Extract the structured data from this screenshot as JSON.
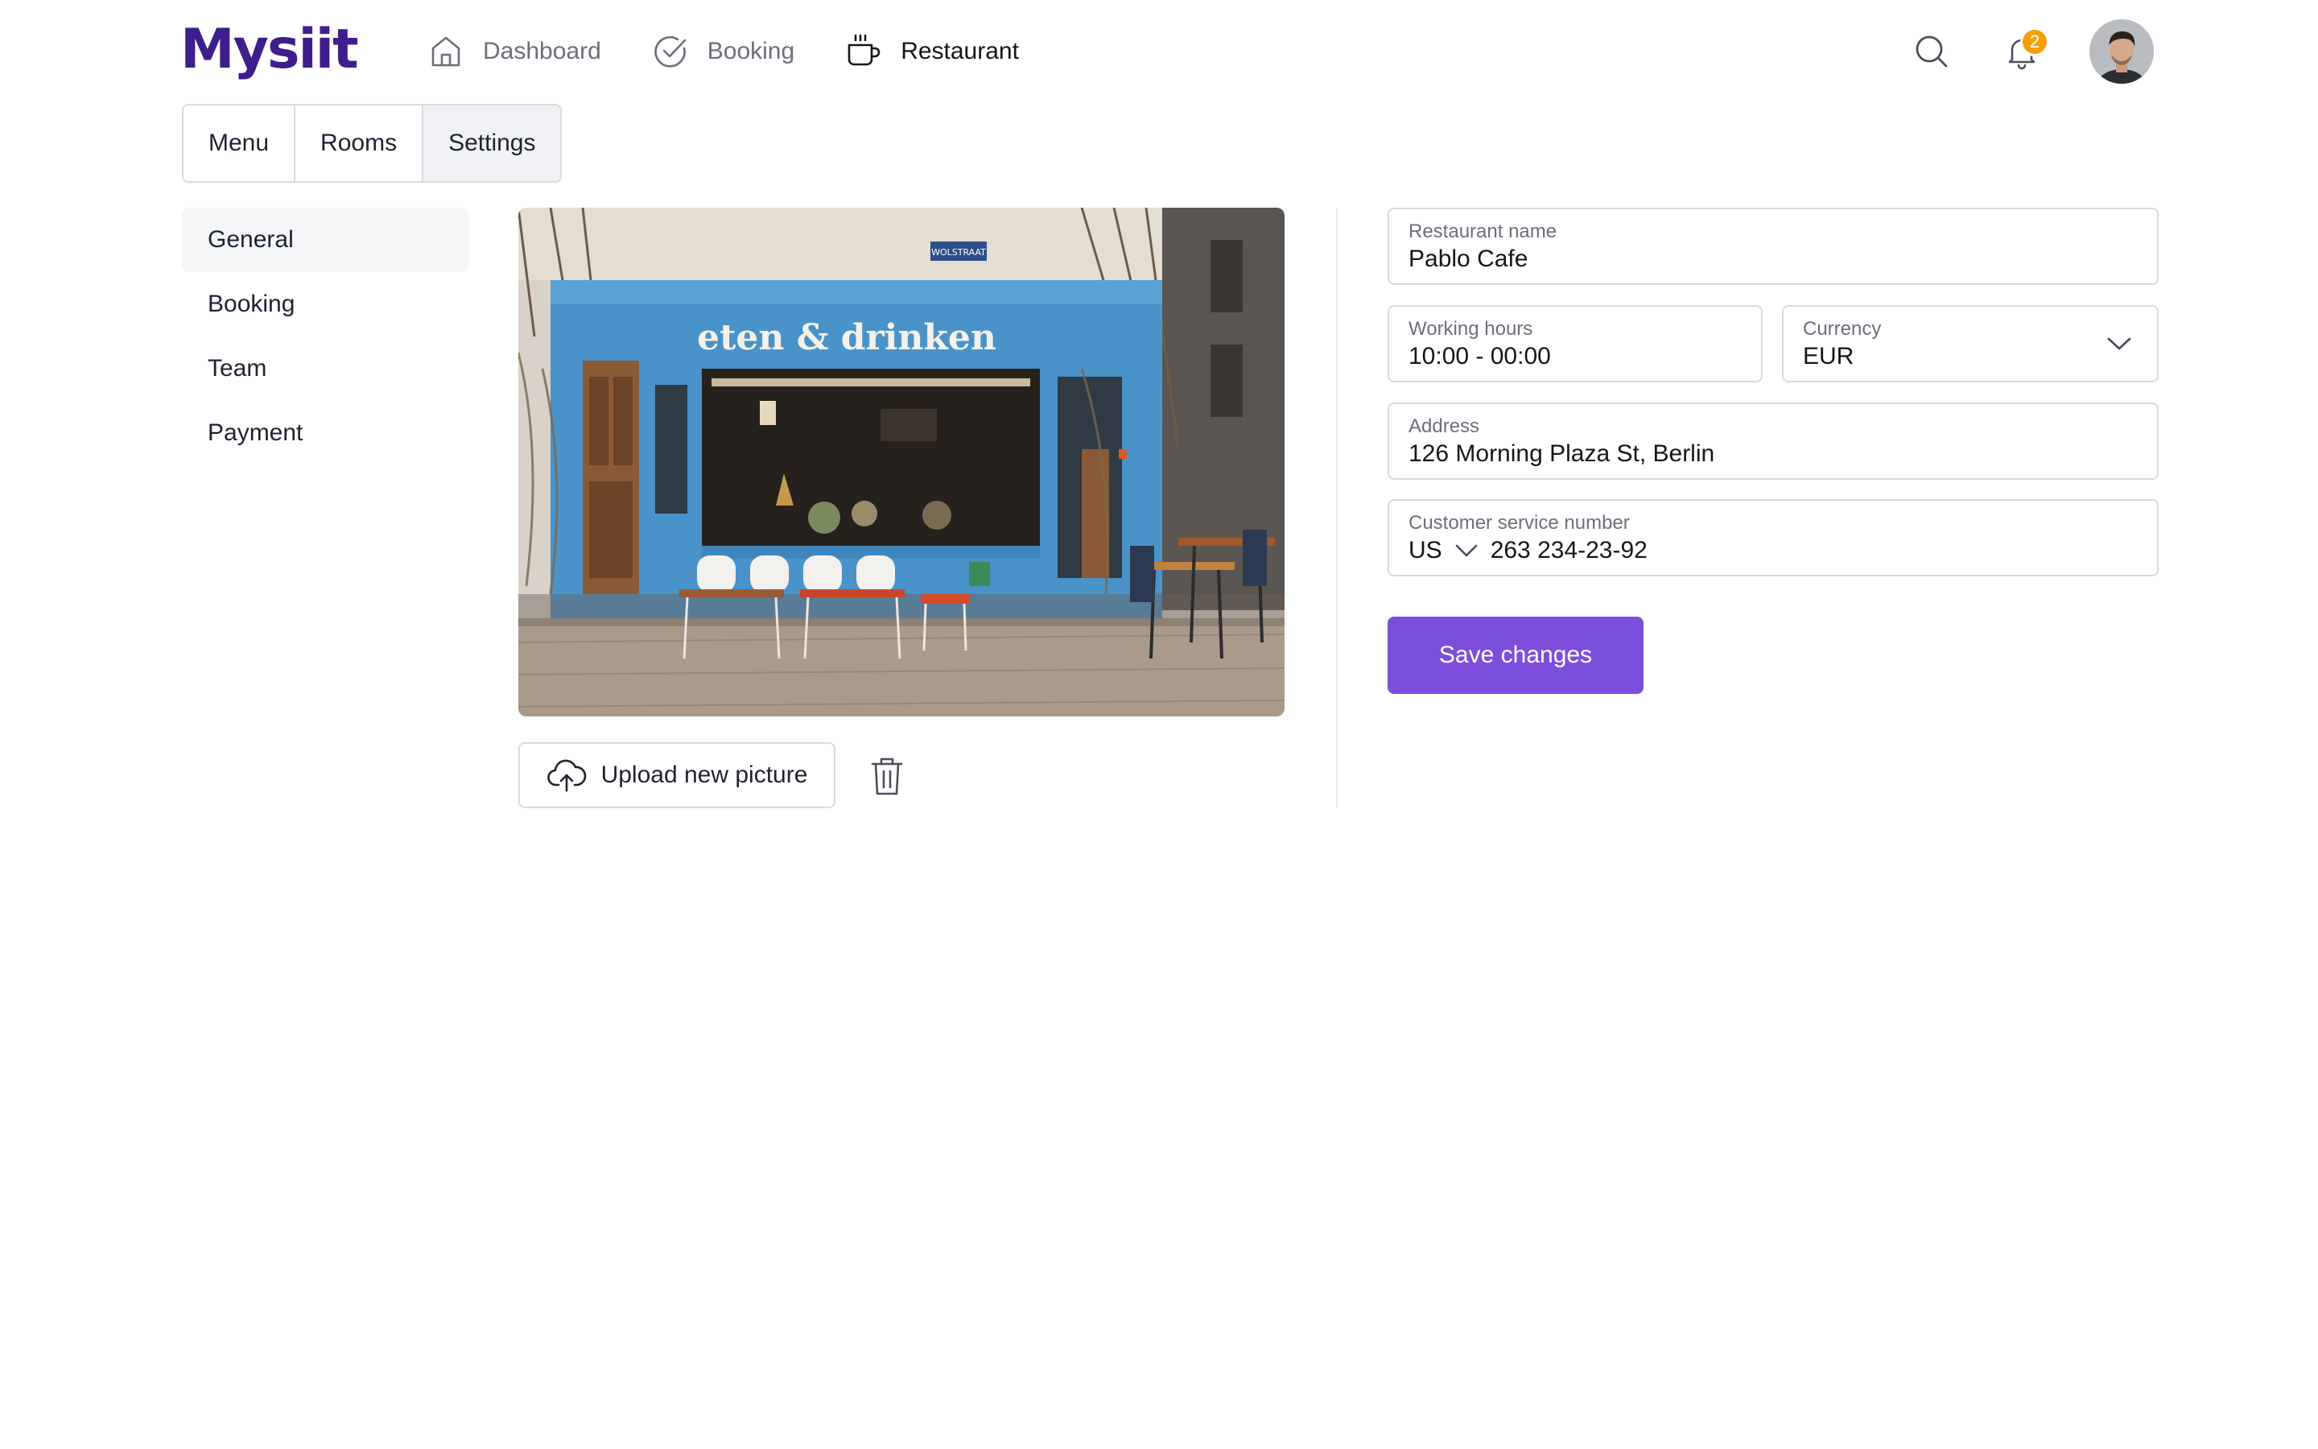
{
  "brand": {
    "logo": "Mysiit",
    "color": "#3f1d8c"
  },
  "nav": {
    "items": [
      {
        "label": "Dashboard",
        "icon": "home-icon",
        "active": false
      },
      {
        "label": "Booking",
        "icon": "check-circle-icon",
        "active": false
      },
      {
        "label": "Restaurant",
        "icon": "coffee-cup-icon",
        "active": true
      }
    ]
  },
  "header": {
    "search_icon": "search-icon",
    "notifications": {
      "icon": "bell-icon",
      "count": "2",
      "badge_color": "#f59e0b"
    },
    "avatar": "user-avatar"
  },
  "tabs": [
    {
      "label": "Menu",
      "active": false
    },
    {
      "label": "Rooms",
      "active": false
    },
    {
      "label": "Settings",
      "active": true
    }
  ],
  "sidemenu": {
    "items": [
      {
        "label": "General",
        "active": true
      },
      {
        "label": "Booking",
        "active": false
      },
      {
        "label": "Team",
        "active": false
      },
      {
        "label": "Payment",
        "active": false
      }
    ]
  },
  "photo": {
    "storefront_sign": "eten & drinken",
    "street_sign": "WOLSTRAAT",
    "upload_label": "Upload new picture",
    "upload_icon": "cloud-upload-icon",
    "delete_icon": "trash-icon"
  },
  "form": {
    "restaurant_name": {
      "label": "Restaurant name",
      "value": "Pablo Cafe"
    },
    "working_hours": {
      "label": "Working hours",
      "value": "10:00 - 00:00"
    },
    "currency": {
      "label": "Currency",
      "value": "EUR"
    },
    "address": {
      "label": "Address",
      "value": "126 Morning Plaza St, Berlin"
    },
    "customer_service": {
      "label": "Customer service number",
      "country": "US",
      "value": "263 234-23-92"
    },
    "save_label": "Save changes",
    "accent_color": "#7b4fdb"
  }
}
